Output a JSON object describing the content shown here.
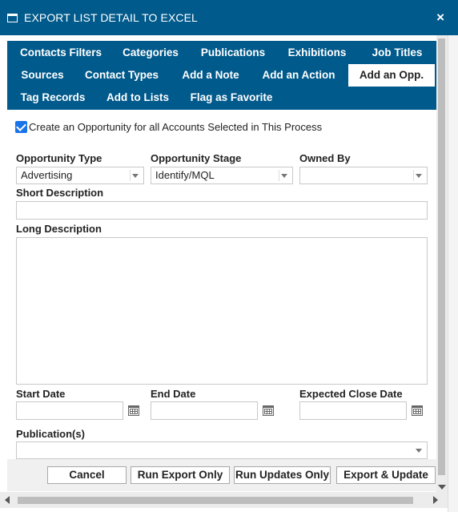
{
  "dialog": {
    "title": "EXPORT LIST DETAIL TO EXCEL",
    "close": "×"
  },
  "tabs": [
    {
      "label": "Contacts Filters"
    },
    {
      "label": "Categories"
    },
    {
      "label": "Publications"
    },
    {
      "label": "Exhibitions"
    },
    {
      "label": "Job Titles"
    },
    {
      "label": "Sources"
    },
    {
      "label": "Contact Types"
    },
    {
      "label": "Add a Note"
    },
    {
      "label": "Add an Action"
    },
    {
      "label": "Add an Opp.",
      "active": true
    },
    {
      "label": "Tag Records"
    },
    {
      "label": "Add to Lists"
    },
    {
      "label": "Flag as Favorite"
    }
  ],
  "form": {
    "create_opp_label": "Create an Opportunity for all Accounts Selected in This Process",
    "create_opp_checked": true,
    "opportunity_type": {
      "label": "Opportunity Type",
      "value": "Advertising"
    },
    "opportunity_stage": {
      "label": "Opportunity Stage",
      "value": "Identify/MQL"
    },
    "owned_by": {
      "label": "Owned By",
      "value": ""
    },
    "short_description": {
      "label": "Short Description",
      "value": ""
    },
    "long_description": {
      "label": "Long Description",
      "value": ""
    },
    "start_date": {
      "label": "Start Date",
      "value": ""
    },
    "end_date": {
      "label": "End Date",
      "value": ""
    },
    "expected_close_date": {
      "label": "Expected Close Date",
      "value": ""
    },
    "publications": {
      "label": "Publication(s)",
      "value": ""
    }
  },
  "buttons": {
    "cancel": "Cancel",
    "run_export_only": "Run Export Only",
    "run_updates_only": "Run Updates Only",
    "export_update": "Export & Update"
  },
  "colors": {
    "primary": "#005a8c",
    "checkbox": "#1a73e8"
  }
}
